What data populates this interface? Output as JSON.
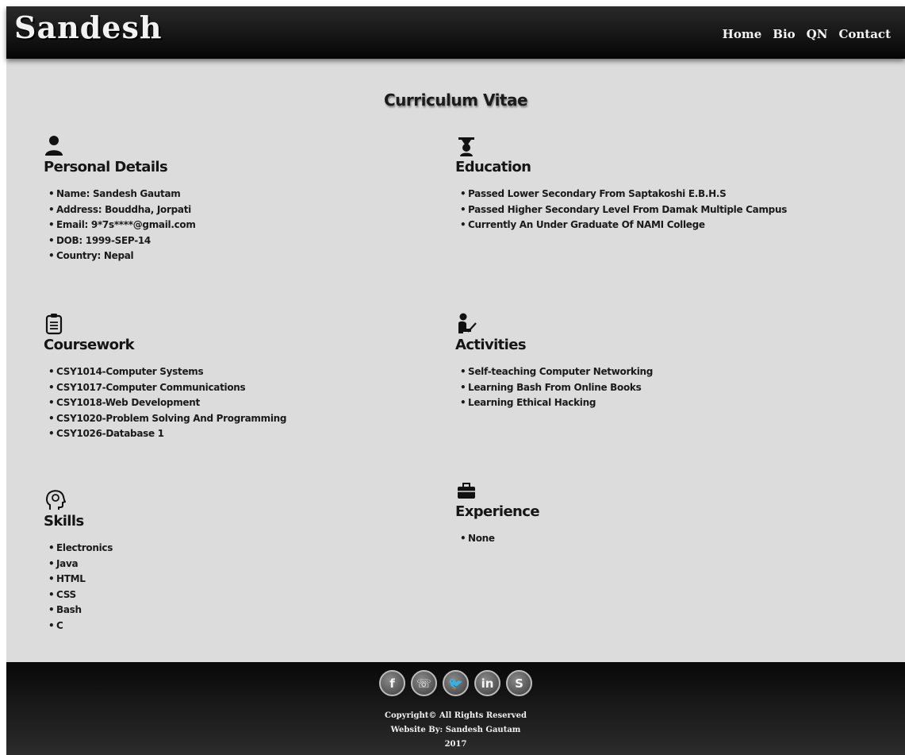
{
  "header": {
    "logo": "Sandesh",
    "nav": [
      "Home",
      "Bio",
      "QN",
      "Contact"
    ]
  },
  "main": {
    "title": "Curriculum Vitae",
    "sections": {
      "personal": {
        "icon": "user-icon",
        "title": "Personal Details",
        "items": [
          "Name: Sandesh Gautam",
          "Address: Bouddha, Jorpati",
          "Email: 9*7s****@gmail.com",
          "DOB: 1999-SEP-14",
          "Country: Nepal"
        ]
      },
      "education": {
        "icon": "graduate-icon",
        "title": "Education",
        "items": [
          "Passed Lower Secondary From Saptakoshi E.B.H.S",
          "Passed Higher Secondary Level From Damak Multiple Campus",
          "Currently An Under Graduate Of NAMI College"
        ]
      },
      "coursework": {
        "icon": "clipboard-icon",
        "title": "Coursework",
        "items": [
          "CSY1014-Computer Systems",
          "CSY1017-Computer Communications",
          "CSY1018-Web Development",
          "CSY1020-Problem Solving And Programming",
          "CSY1026-Database 1"
        ]
      },
      "activities": {
        "icon": "reading-person-icon",
        "title": "Activities",
        "items": [
          "Self-teaching Computer Networking",
          "Learning Bash From Online Books",
          "Learning Ethical Hacking"
        ]
      },
      "skills": {
        "icon": "head-idea-icon",
        "title": "Skills",
        "items": [
          "Electronics",
          "Java",
          "HTML",
          "CSS",
          "Bash",
          "C"
        ]
      },
      "experience": {
        "icon": "briefcase-icon",
        "title": "Experience",
        "items": [
          "None"
        ]
      }
    }
  },
  "footer": {
    "social": [
      {
        "name": "facebook-icon",
        "glyph": "f"
      },
      {
        "name": "viber-icon",
        "glyph": "☏"
      },
      {
        "name": "twitter-icon",
        "glyph": "🐦"
      },
      {
        "name": "linkedin-icon",
        "glyph": "in"
      },
      {
        "name": "skype-icon",
        "glyph": "S"
      }
    ],
    "copyright": "Copyright© All Rights Reserved",
    "credit": "Website By: Sandesh Gautam",
    "year": "2017"
  }
}
